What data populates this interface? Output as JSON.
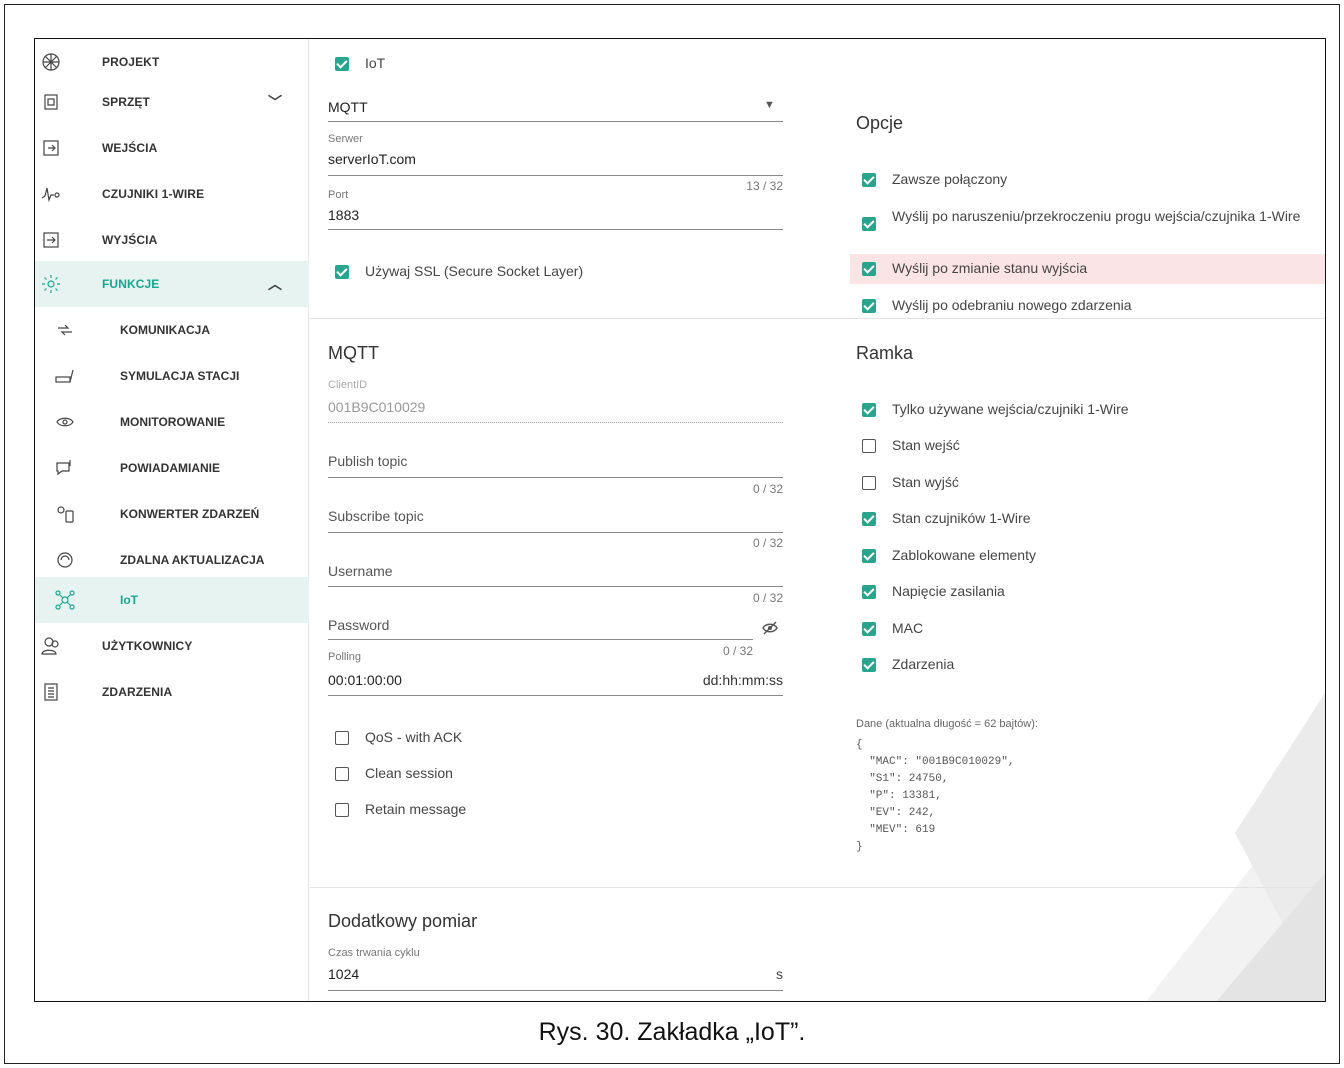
{
  "caption": "Rys. 30. Zakładka „IoT”.",
  "sidebar": {
    "items": [
      {
        "label": "PROJEKT",
        "icon": "project-icon"
      },
      {
        "label": "SPRZĘT",
        "icon": "hardware-icon",
        "chevron": "﹀"
      },
      {
        "label": "WEJŚCIA",
        "icon": "inputs-icon"
      },
      {
        "label": "CZUJNIKI 1-WIRE",
        "icon": "sensor-icon"
      },
      {
        "label": "WYJŚCIA",
        "icon": "outputs-icon"
      },
      {
        "label": "FUNKCJE",
        "icon": "gear-icon",
        "chevron": "︿"
      }
    ],
    "sub_items": [
      {
        "label": "KOMUNIKACJA",
        "icon": "communication-icon"
      },
      {
        "label": "SYMULACJA STACJI",
        "icon": "station-simulation-icon"
      },
      {
        "label": "MONITOROWANIE",
        "icon": "eye-icon"
      },
      {
        "label": "POWIADAMIANIE",
        "icon": "notification-icon"
      },
      {
        "label": "KONWERTER ZDARZEŃ",
        "icon": "event-converter-icon"
      },
      {
        "label": "ZDALNA AKTUALIZACJA",
        "icon": "remote-update-icon"
      },
      {
        "label": "IoT",
        "icon": "iot-icon"
      }
    ],
    "bottom_items": [
      {
        "label": "UŻYTKOWNICY",
        "icon": "users-icon"
      },
      {
        "label": "ZDARZENIA",
        "icon": "events-icon"
      }
    ]
  },
  "iot": {
    "enabled_label": "IoT",
    "protocol_value": "MQTT",
    "server_label": "Serwer",
    "server_value": "serverIoT.com",
    "server_counter": "13 / 32",
    "port_label": "Port",
    "port_value": "1883",
    "ssl_label": "Używaj SSL (Secure Socket Layer)"
  },
  "opcje": {
    "title": "Opcje",
    "items": [
      {
        "label": "Zawsze połączony",
        "checked": true
      },
      {
        "label": "Wyślij po naruszeniu/przekroczeniu progu wejścia/czujnika 1-Wire",
        "checked": true
      },
      {
        "label": "Wyślij po zmianie stanu wyjścia",
        "checked": true
      },
      {
        "label": "Wyślij po odebraniu nowego zdarzenia",
        "checked": true
      }
    ]
  },
  "mqtt": {
    "title": "MQTT",
    "client_id_label": "ClientID",
    "client_id_value": "001B9C010029",
    "publish_topic": "Publish topic",
    "publish_counter": "0 / 32",
    "subscribe_topic": "Subscribe topic",
    "subscribe_counter": "0 / 32",
    "username": "Username",
    "username_counter": "0 / 32",
    "password": "Password",
    "password_counter": "0 / 32",
    "polling_label": "Polling",
    "polling_value": "00:01:00:00",
    "polling_format": "dd:hh:mm:ss",
    "qos_label": "QoS - with ACK",
    "clean_session_label": "Clean session",
    "retain_label": "Retain message"
  },
  "ramka": {
    "title": "Ramka",
    "items": [
      {
        "label": "Tylko używane wejścia/czujniki 1-Wire",
        "checked": true
      },
      {
        "label": "Stan wejść",
        "checked": false
      },
      {
        "label": "Stan wyjść",
        "checked": false
      },
      {
        "label": "Stan czujników 1-Wire",
        "checked": true
      },
      {
        "label": "Zablokowane elementy",
        "checked": true
      },
      {
        "label": "Napięcie zasilania",
        "checked": true
      },
      {
        "label": "MAC",
        "checked": true
      },
      {
        "label": "Zdarzenia",
        "checked": true
      }
    ],
    "data_label": "Dane (aktualna długość = 62 bajtów):",
    "data_json": "{\n  \"MAC\": \"001B9C010029\",\n  \"S1\": 24750,\n  \"P\": 13381,\n  \"EV\": 242,\n  \"MEV\": 619\n}"
  },
  "dodatkowy": {
    "title": "Dodatkowy pomiar",
    "cycle_label": "Czas trwania cyklu",
    "cycle_value": "1024",
    "cycle_unit": "s"
  },
  "colors": {
    "accent": "#2aa58d",
    "active_bg": "#e6f3f1",
    "highlight_row": "#fbe4e6"
  }
}
